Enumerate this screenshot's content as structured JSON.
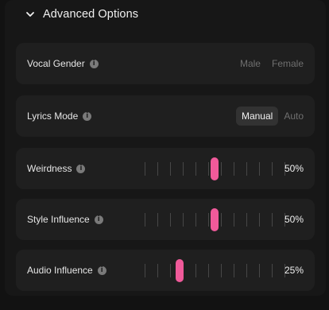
{
  "advanced": {
    "title": "Advanced Options"
  },
  "vocal_gender": {
    "label": "Vocal Gender",
    "options": [
      "Male",
      "Female"
    ],
    "selected": null
  },
  "lyrics_mode": {
    "label": "Lyrics Mode",
    "options": [
      "Manual",
      "Auto"
    ],
    "selected": "Manual"
  },
  "weirdness": {
    "label": "Weirdness",
    "value": "50%",
    "level": 0.5
  },
  "style_influence": {
    "label": "Style Influence",
    "value": "50%",
    "level": 0.5
  },
  "audio_influence": {
    "label": "Audio Influence",
    "value": "25%",
    "level": 0.25
  },
  "colors": {
    "accent": "#f05a9a",
    "card": "#1f1f1f",
    "panel": "#171717"
  },
  "icons": {
    "collapse": "chevron-down-icon",
    "info": "info-icon"
  }
}
